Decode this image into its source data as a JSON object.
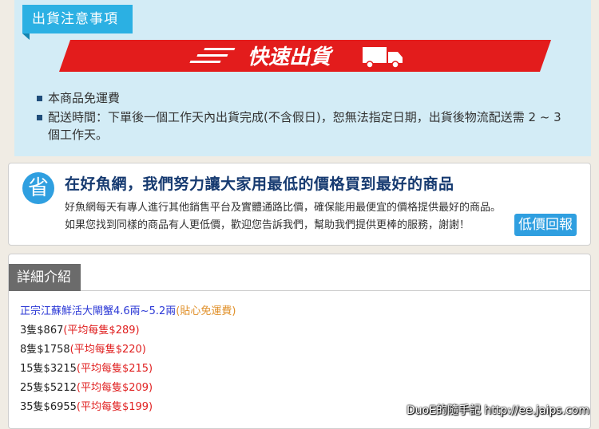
{
  "shipping": {
    "tab_label": "出貨注意事項",
    "banner_text": "快速出貨",
    "notes": [
      "本商品免運費",
      "配送時間：下單後一個工作天內出貨完成(不含假日)，恕無法指定日期，出貨後物流配送需 2 ~ 3 個工作天。"
    ]
  },
  "promo": {
    "badge": "省",
    "title": "在好魚網，我們努力讓大家用最低的價格買到最好的商品",
    "line1": "好魚網每天有專人進行其他銷售平台及實體通路比價，確保能用最便宜的價格提供最好的商品。",
    "line2": "如果您找到同樣的商品有人更低價，歡迎您告訴我們，幫助我們提供更棒的服務，謝謝！",
    "button_label": "低價回報"
  },
  "detail": {
    "tab_label": "詳細介紹",
    "product_title": "正宗江蘇鮮活大閘蟹4.6兩~5.2兩",
    "product_note": "(貼心免運費)",
    "tiers": [
      {
        "qty_price": "3隻$867",
        "avg": "(平均每隻$289)"
      },
      {
        "qty_price": "8隻$1758",
        "avg": "(平均每隻$220)"
      },
      {
        "qty_price": "15隻$3215",
        "avg": "(平均每隻$215)"
      },
      {
        "qty_price": "25隻$5212",
        "avg": "(平均每隻$209)"
      },
      {
        "qty_price": "35隻$6955",
        "avg": "(平均每隻$199)"
      }
    ]
  },
  "watermark": "DuoE的隨手記 http://ee.jaips.com",
  "colors": {
    "banner_red": "#e31c1c",
    "tab_blue": "#2bb0e3",
    "title_navy": "#163a70",
    "price_red": "#e02020",
    "link_blue": "#2d3ad6"
  }
}
